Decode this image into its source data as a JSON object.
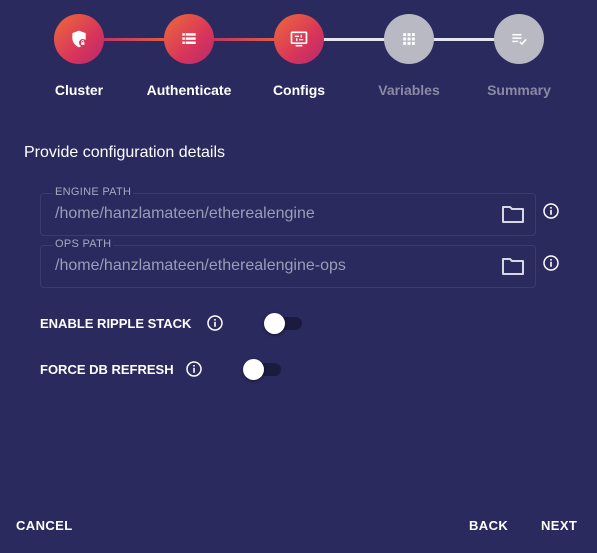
{
  "stepper": {
    "steps": [
      {
        "label": "Cluster",
        "state": "done",
        "icon": "shield-lock-icon"
      },
      {
        "label": "Authenticate",
        "state": "done",
        "icon": "list-icon"
      },
      {
        "label": "Configs",
        "state": "active",
        "icon": "settings-panel-icon"
      },
      {
        "label": "Variables",
        "state": "inactive",
        "icon": "grid-icon"
      },
      {
        "label": "Summary",
        "state": "inactive",
        "icon": "checklist-icon"
      }
    ]
  },
  "form": {
    "title": "Provide configuration details",
    "engine_path": {
      "label": "ENGINE PATH",
      "value": "/home/hanzlamateen/etherealengine"
    },
    "ops_path": {
      "label": "OPS PATH",
      "value": "/home/hanzlamateen/etherealengine-ops"
    },
    "ripple_stack": {
      "label": "ENABLE RIPPLE STACK",
      "checked": false
    },
    "force_db_refresh": {
      "label": "FORCE DB REFRESH",
      "checked": false
    }
  },
  "footer": {
    "cancel_label": "CANCEL",
    "back_label": "BACK",
    "next_label": "NEXT"
  },
  "colors": {
    "background": "#2b2a5e",
    "accent_start": "#ef6a3a",
    "accent_end": "#b72a6e",
    "inactive": "#b9b9c4"
  }
}
